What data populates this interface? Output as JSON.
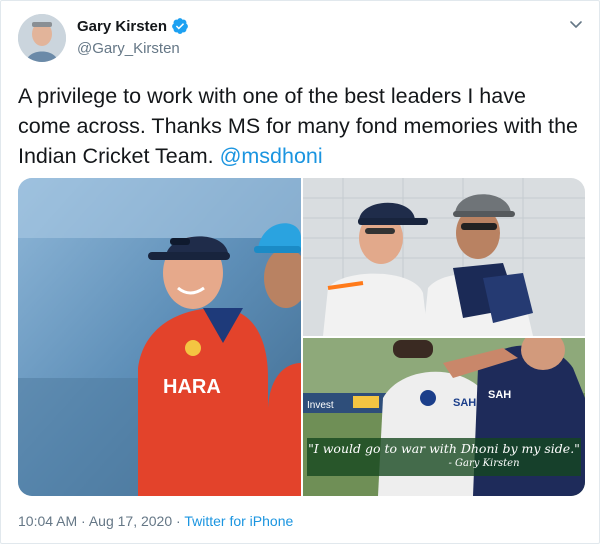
{
  "tweet": {
    "author_name": "Gary Kirsten",
    "author_handle": "@Gary_Kirsten",
    "text_main": "A privilege to work with one of the best leaders I have come across. Thanks MS for many fond memories with the Indian Cricket Team. ",
    "mention": "@msdhoni",
    "verified_icon": "verified-badge-icon",
    "menu_icon": "chevron-down-icon"
  },
  "media": {
    "image1": {
      "jersey_text": "HARA"
    },
    "image3": {
      "quote": "\"I would go to war with Dhoni by my side.\"",
      "quote_author": "- Gary Kirsten",
      "board_text": "Invest",
      "sponsor_text_1": "SAH",
      "sponsor_text_2": "SAH"
    }
  },
  "footer": {
    "time": "10:04 AM",
    "separator": " · ",
    "date": "Aug 17, 2020",
    "separator2": " · ",
    "source": "Twitter for iPhone"
  },
  "colors": {
    "link": "#1b95e0",
    "muted": "#657786",
    "text": "#14171a"
  }
}
